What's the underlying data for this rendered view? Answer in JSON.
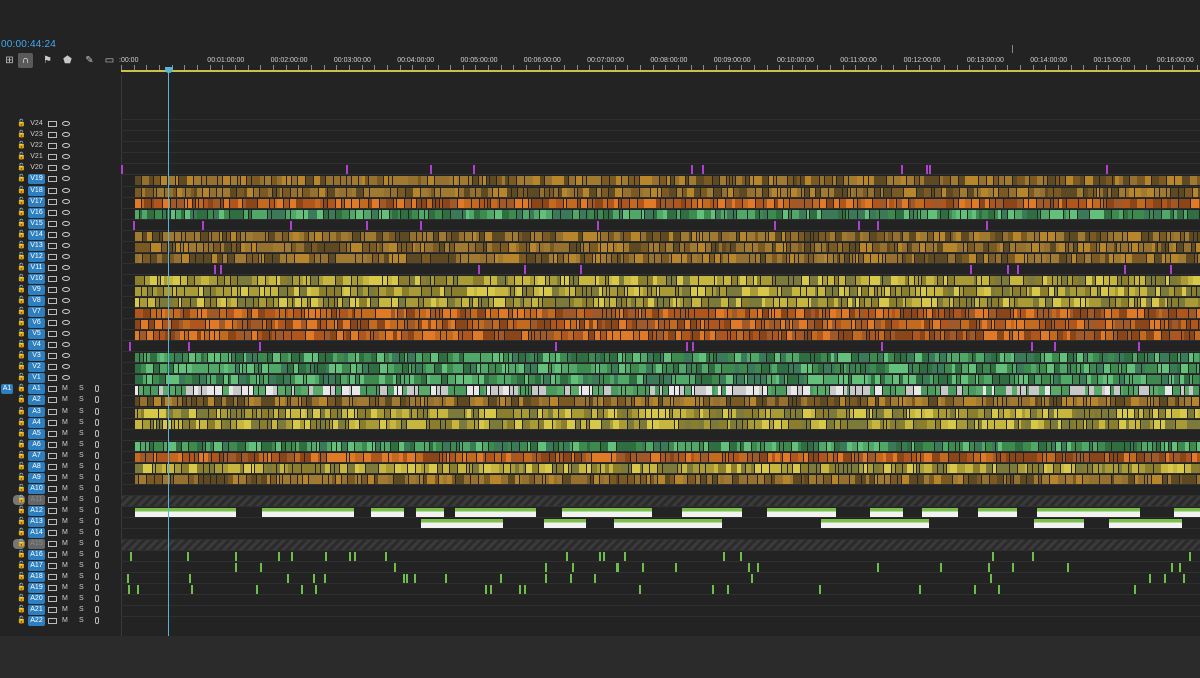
{
  "timecode": "00:00:44:24",
  "toolbar": [
    {
      "name": "insert-overwrite-icon",
      "glyph": "⊞"
    },
    {
      "name": "snap-icon",
      "glyph": "∩",
      "active": true
    },
    {
      "name": "linked-selection-icon",
      "glyph": "⚑"
    },
    {
      "name": "add-marker-icon",
      "glyph": "⬟"
    },
    {
      "name": "settings-wrench-icon",
      "glyph": "✎"
    },
    {
      "name": "captions-icon",
      "glyph": "▭"
    }
  ],
  "ruler": {
    "labels": [
      ":00:00",
      "00:01:00:00",
      "00:02:00:00",
      "00:03:00:00",
      "00:04:00:00",
      "00:05:00:00",
      "00:06:00:00",
      "00:07:00:00",
      "00:08:00:00",
      "00:09:00:00",
      "00:10:00:00",
      "00:11:00:00",
      "00:12:00:00",
      "00:13:00:00",
      "00:14:00:00",
      "00:15:00:00",
      "00:16:00:00"
    ]
  },
  "colors": {
    "orange_tan": "#8a6a2a",
    "orange": "#c46a1e",
    "green": "#3f9a55",
    "yellow": "#bdb43a",
    "audio_green": "#6cc04a",
    "violet": "#b040d0",
    "playhead": "#58b4d8"
  },
  "video_tracks": [
    {
      "name": "V24",
      "style": "empty"
    },
    {
      "name": "V23",
      "style": "empty"
    },
    {
      "name": "V22",
      "style": "empty"
    },
    {
      "name": "V21",
      "style": "empty"
    },
    {
      "name": "V20",
      "style": "sparse"
    },
    {
      "name": "V19",
      "style": "tan"
    },
    {
      "name": "V18",
      "style": "tan"
    },
    {
      "name": "V17",
      "style": "orange"
    },
    {
      "name": "V16",
      "style": "green"
    },
    {
      "name": "V15",
      "style": "sparse"
    },
    {
      "name": "V14",
      "style": "tan"
    },
    {
      "name": "V13",
      "style": "tan"
    },
    {
      "name": "V12",
      "style": "tan"
    },
    {
      "name": "V11",
      "style": "sparse"
    },
    {
      "name": "V10",
      "style": "yellow"
    },
    {
      "name": "V9",
      "style": "yellow"
    },
    {
      "name": "V8",
      "style": "yellow"
    },
    {
      "name": "V7",
      "style": "orange"
    },
    {
      "name": "V6",
      "style": "orange"
    },
    {
      "name": "V5",
      "style": "orange"
    },
    {
      "name": "V4",
      "style": "sparse"
    },
    {
      "name": "V3",
      "style": "green"
    },
    {
      "name": "V2",
      "style": "green"
    },
    {
      "name": "V1",
      "style": "green"
    }
  ],
  "audio_tracks": [
    {
      "name": "A1",
      "source": "A1",
      "style": "white"
    },
    {
      "name": "A2",
      "style": "tan"
    },
    {
      "name": "A3",
      "style": "yellow"
    },
    {
      "name": "A4",
      "style": "yellow"
    },
    {
      "name": "A5",
      "style": "empty"
    },
    {
      "name": "A6",
      "style": "green"
    },
    {
      "name": "A7",
      "style": "orange"
    },
    {
      "name": "A8",
      "style": "yellow"
    },
    {
      "name": "A9",
      "style": "tan"
    },
    {
      "name": "A10",
      "style": "empty"
    },
    {
      "name": "A11",
      "style": "hatched",
      "locked": true
    },
    {
      "name": "A12",
      "style": "whiteblocks"
    },
    {
      "name": "A13",
      "style": "whiteblocks2"
    },
    {
      "name": "A14",
      "style": "empty"
    },
    {
      "name": "A15",
      "style": "hatched",
      "locked": true
    },
    {
      "name": "A16",
      "style": "spikes"
    },
    {
      "name": "A17",
      "style": "spikes"
    },
    {
      "name": "A18",
      "style": "spikes"
    },
    {
      "name": "A19",
      "style": "spikes"
    },
    {
      "name": "A20",
      "style": "empty"
    },
    {
      "name": "A21",
      "style": "empty"
    },
    {
      "name": "A22",
      "style": "empty"
    }
  ],
  "audio_buttons": {
    "mute": "M",
    "solo": "S"
  }
}
